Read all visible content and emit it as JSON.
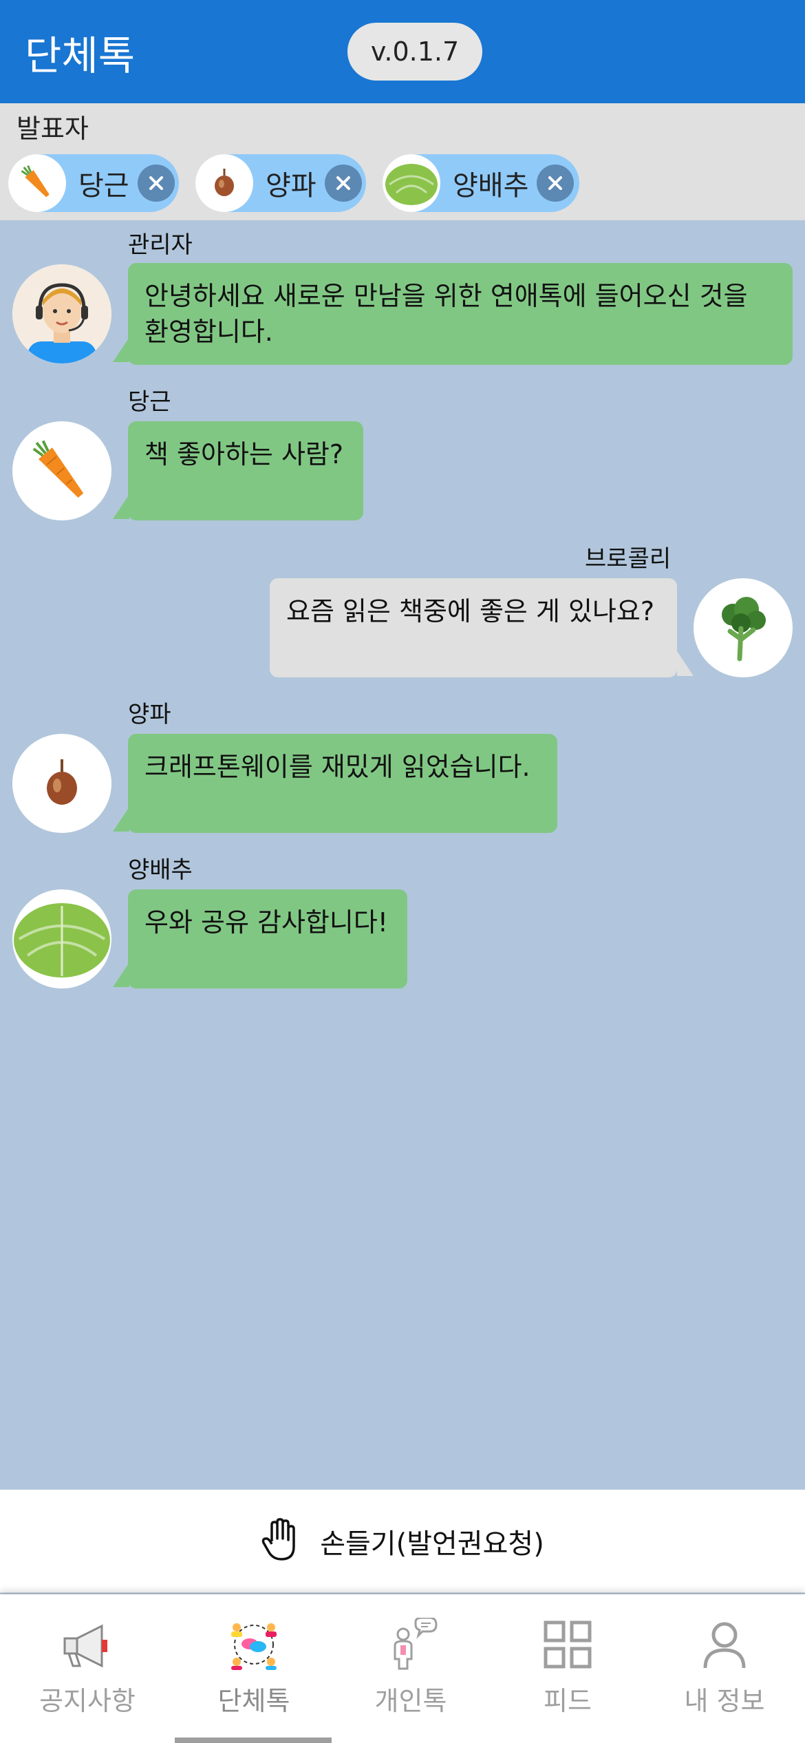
{
  "header": {
    "title": "단체톡",
    "version": "v.0.1.7"
  },
  "presenters": {
    "label": "발표자",
    "chips": [
      {
        "name": "당근",
        "icon": "carrot-avatar"
      },
      {
        "name": "양파",
        "icon": "onion-avatar"
      },
      {
        "name": "양배추",
        "icon": "cabbage-avatar"
      }
    ]
  },
  "messages": [
    {
      "sender": "관리자",
      "text_line1": "안녕하세요 새로운 만남을 위한 연애톡에 들어오신 것을",
      "text_line2": "환영합니다.",
      "side": "left",
      "color": "#81c784"
    },
    {
      "sender": "당근",
      "text": "책 좋아하는 사람?",
      "side": "left",
      "color": "#81c784"
    },
    {
      "sender": "브로콜리",
      "text": "요즘 읽은 책중에 좋은 게 있나요?",
      "side": "right",
      "color": "#e0e0e0"
    },
    {
      "sender": "양파",
      "text": "크래프톤웨이를 재밌게 읽었습니다.",
      "side": "left",
      "color": "#81c784"
    },
    {
      "sender": "양배추",
      "text": "우와 공유 감사합니다!",
      "side": "left",
      "color": "#81c784"
    }
  ],
  "raise_hand": {
    "label": "손들기(발언권요청)",
    "icon": "raised-hand-icon"
  },
  "bottom_nav": {
    "items": [
      {
        "label": "공지사항",
        "icon": "megaphone-icon"
      },
      {
        "label": "단체톡",
        "icon": "group-chat-icon",
        "active": true
      },
      {
        "label": "개인톡",
        "icon": "person-chat-icon"
      },
      {
        "label": "피드",
        "icon": "grid-icon"
      },
      {
        "label": "내 정보",
        "icon": "profile-icon"
      }
    ]
  },
  "colors": {
    "appbar": "#1976d2",
    "chat_background": "#b1c6dc",
    "bubble_other": "#81c784",
    "bubble_mine": "#e0e0e0",
    "chip": "#90caf9"
  }
}
